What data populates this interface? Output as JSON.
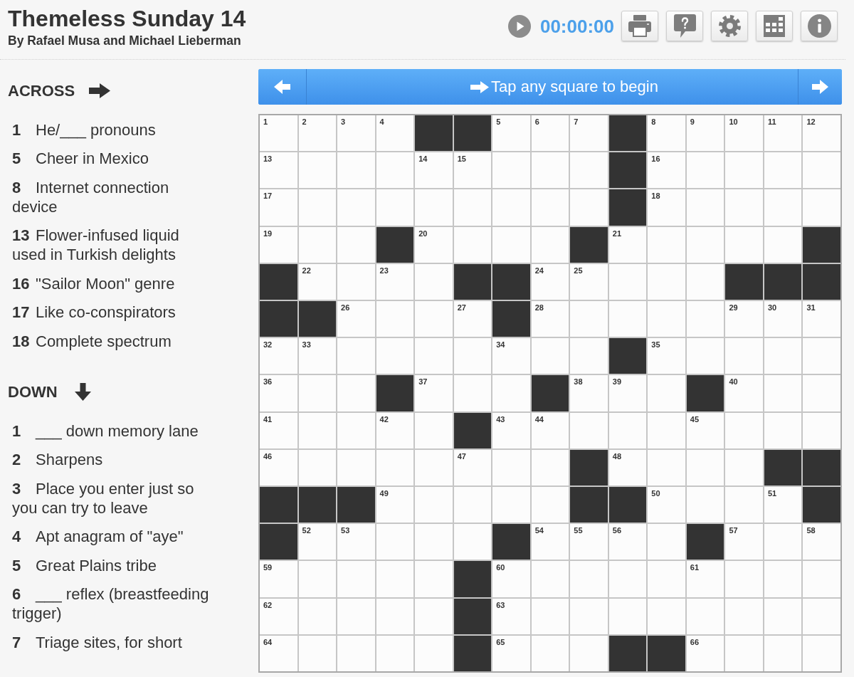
{
  "header": {
    "title": "Themeless Sunday 14",
    "byline": "By Rafael Musa and Michael Lieberman"
  },
  "toolbar": {
    "timer": "00:00:00"
  },
  "clue_bar": {
    "message": "Tap any square to begin"
  },
  "clues": {
    "across": {
      "heading": "ACROSS",
      "items": [
        {
          "number": "1",
          "text": "He/___ pronouns"
        },
        {
          "number": "5",
          "text": "Cheer in Mexico"
        },
        {
          "number": "8",
          "text": "Internet connection device"
        },
        {
          "number": "13",
          "text": "Flower-infused liquid used in Turkish delights"
        },
        {
          "number": "16",
          "text": "\"Sailor Moon\" genre"
        },
        {
          "number": "17",
          "text": "Like co-conspirators"
        },
        {
          "number": "18",
          "text": "Complete spectrum"
        }
      ]
    },
    "down": {
      "heading": "DOWN",
      "items": [
        {
          "number": "1",
          "text": "___ down memory lane"
        },
        {
          "number": "2",
          "text": "Sharpens"
        },
        {
          "number": "3",
          "text": "Place you enter just so you can try to leave"
        },
        {
          "number": "4",
          "text": "Apt anagram of \"aye\""
        },
        {
          "number": "5",
          "text": "Great Plains tribe"
        },
        {
          "number": "6",
          "text": "___ reflex (breastfeeding trigger)"
        },
        {
          "number": "7",
          "text": "Triage sites, for short"
        }
      ]
    }
  },
  "grid": {
    "rows": [
      [
        {
          "kind": "open",
          "number": "1"
        },
        {
          "kind": "open",
          "number": "2"
        },
        {
          "kind": "open",
          "number": "3"
        },
        {
          "kind": "open",
          "number": "4"
        },
        {
          "kind": "block"
        },
        {
          "kind": "block"
        },
        {
          "kind": "open",
          "number": "5"
        },
        {
          "kind": "open",
          "number": "6"
        },
        {
          "kind": "open",
          "number": "7"
        },
        {
          "kind": "block"
        },
        {
          "kind": "open",
          "number": "8"
        },
        {
          "kind": "open",
          "number": "9"
        },
        {
          "kind": "open",
          "number": "10"
        },
        {
          "kind": "open",
          "number": "11"
        },
        {
          "kind": "open",
          "number": "12"
        }
      ],
      [
        {
          "kind": "open",
          "number": "13"
        },
        {
          "kind": "open"
        },
        {
          "kind": "open"
        },
        {
          "kind": "open"
        },
        {
          "kind": "open",
          "number": "14"
        },
        {
          "kind": "open",
          "number": "15"
        },
        {
          "kind": "open"
        },
        {
          "kind": "open"
        },
        {
          "kind": "open"
        },
        {
          "kind": "block"
        },
        {
          "kind": "open",
          "number": "16"
        },
        {
          "kind": "open"
        },
        {
          "kind": "open"
        },
        {
          "kind": "open"
        },
        {
          "kind": "open"
        }
      ],
      [
        {
          "kind": "open",
          "number": "17"
        },
        {
          "kind": "open"
        },
        {
          "kind": "open"
        },
        {
          "kind": "open"
        },
        {
          "kind": "open"
        },
        {
          "kind": "open"
        },
        {
          "kind": "open"
        },
        {
          "kind": "open"
        },
        {
          "kind": "open"
        },
        {
          "kind": "block"
        },
        {
          "kind": "open",
          "number": "18"
        },
        {
          "kind": "open"
        },
        {
          "kind": "open"
        },
        {
          "kind": "open"
        },
        {
          "kind": "open"
        }
      ],
      [
        {
          "kind": "open",
          "number": "19"
        },
        {
          "kind": "open"
        },
        {
          "kind": "open"
        },
        {
          "kind": "block"
        },
        {
          "kind": "open",
          "number": "20"
        },
        {
          "kind": "open"
        },
        {
          "kind": "open"
        },
        {
          "kind": "open"
        },
        {
          "kind": "block"
        },
        {
          "kind": "open",
          "number": "21"
        },
        {
          "kind": "open"
        },
        {
          "kind": "open"
        },
        {
          "kind": "open"
        },
        {
          "kind": "open"
        },
        {
          "kind": "block"
        }
      ],
      [
        {
          "kind": "block"
        },
        {
          "kind": "open",
          "number": "22"
        },
        {
          "kind": "open"
        },
        {
          "kind": "open",
          "number": "23"
        },
        {
          "kind": "open"
        },
        {
          "kind": "block"
        },
        {
          "kind": "block"
        },
        {
          "kind": "open",
          "number": "24"
        },
        {
          "kind": "open",
          "number": "25"
        },
        {
          "kind": "open"
        },
        {
          "kind": "open"
        },
        {
          "kind": "open"
        },
        {
          "kind": "block"
        },
        {
          "kind": "block"
        },
        {
          "kind": "block"
        }
      ],
      [
        {
          "kind": "block"
        },
        {
          "kind": "block"
        },
        {
          "kind": "open",
          "number": "26"
        },
        {
          "kind": "open"
        },
        {
          "kind": "open"
        },
        {
          "kind": "open",
          "number": "27"
        },
        {
          "kind": "block"
        },
        {
          "kind": "open",
          "number": "28"
        },
        {
          "kind": "open"
        },
        {
          "kind": "open"
        },
        {
          "kind": "open"
        },
        {
          "kind": "open"
        },
        {
          "kind": "open",
          "number": "29"
        },
        {
          "kind": "open",
          "number": "30"
        },
        {
          "kind": "open",
          "number": "31"
        }
      ],
      [
        {
          "kind": "open",
          "number": "32"
        },
        {
          "kind": "open",
          "number": "33"
        },
        {
          "kind": "open"
        },
        {
          "kind": "open"
        },
        {
          "kind": "open"
        },
        {
          "kind": "open"
        },
        {
          "kind": "open",
          "number": "34"
        },
        {
          "kind": "open"
        },
        {
          "kind": "open"
        },
        {
          "kind": "block"
        },
        {
          "kind": "open",
          "number": "35"
        },
        {
          "kind": "open"
        },
        {
          "kind": "open"
        },
        {
          "kind": "open"
        },
        {
          "kind": "open"
        }
      ],
      [
        {
          "kind": "open",
          "number": "36"
        },
        {
          "kind": "open"
        },
        {
          "kind": "open"
        },
        {
          "kind": "block"
        },
        {
          "kind": "open",
          "number": "37"
        },
        {
          "kind": "open"
        },
        {
          "kind": "open"
        },
        {
          "kind": "block"
        },
        {
          "kind": "open",
          "number": "38"
        },
        {
          "kind": "open",
          "number": "39"
        },
        {
          "kind": "open"
        },
        {
          "kind": "block"
        },
        {
          "kind": "open",
          "number": "40"
        },
        {
          "kind": "open"
        },
        {
          "kind": "open"
        }
      ],
      [
        {
          "kind": "open",
          "number": "41"
        },
        {
          "kind": "open"
        },
        {
          "kind": "open"
        },
        {
          "kind": "open",
          "number": "42"
        },
        {
          "kind": "open"
        },
        {
          "kind": "block"
        },
        {
          "kind": "open",
          "number": "43"
        },
        {
          "kind": "open",
          "number": "44"
        },
        {
          "kind": "open"
        },
        {
          "kind": "open"
        },
        {
          "kind": "open"
        },
        {
          "kind": "open",
          "number": "45"
        },
        {
          "kind": "open"
        },
        {
          "kind": "open"
        },
        {
          "kind": "open"
        }
      ],
      [
        {
          "kind": "open",
          "number": "46"
        },
        {
          "kind": "open"
        },
        {
          "kind": "open"
        },
        {
          "kind": "open"
        },
        {
          "kind": "open"
        },
        {
          "kind": "open",
          "number": "47"
        },
        {
          "kind": "open"
        },
        {
          "kind": "open"
        },
        {
          "kind": "block"
        },
        {
          "kind": "open",
          "number": "48"
        },
        {
          "kind": "open"
        },
        {
          "kind": "open"
        },
        {
          "kind": "open"
        },
        {
          "kind": "block"
        },
        {
          "kind": "block"
        }
      ],
      [
        {
          "kind": "block"
        },
        {
          "kind": "block"
        },
        {
          "kind": "block"
        },
        {
          "kind": "open",
          "number": "49"
        },
        {
          "kind": "open"
        },
        {
          "kind": "open"
        },
        {
          "kind": "open"
        },
        {
          "kind": "open"
        },
        {
          "kind": "block"
        },
        {
          "kind": "block"
        },
        {
          "kind": "open",
          "number": "50"
        },
        {
          "kind": "open"
        },
        {
          "kind": "open"
        },
        {
          "kind": "open",
          "number": "51"
        },
        {
          "kind": "block"
        }
      ],
      [
        {
          "kind": "block"
        },
        {
          "kind": "open",
          "number": "52"
        },
        {
          "kind": "open",
          "number": "53"
        },
        {
          "kind": "open"
        },
        {
          "kind": "open"
        },
        {
          "kind": "open"
        },
        {
          "kind": "block"
        },
        {
          "kind": "open",
          "number": "54"
        },
        {
          "kind": "open",
          "number": "55"
        },
        {
          "kind": "open",
          "number": "56"
        },
        {
          "kind": "open"
        },
        {
          "kind": "block"
        },
        {
          "kind": "open",
          "number": "57"
        },
        {
          "kind": "open"
        },
        {
          "kind": "open",
          "number": "58"
        }
      ],
      [
        {
          "kind": "open",
          "number": "59"
        },
        {
          "kind": "open"
        },
        {
          "kind": "open"
        },
        {
          "kind": "open"
        },
        {
          "kind": "open"
        },
        {
          "kind": "block"
        },
        {
          "kind": "open",
          "number": "60"
        },
        {
          "kind": "open"
        },
        {
          "kind": "open"
        },
        {
          "kind": "open"
        },
        {
          "kind": "open"
        },
        {
          "kind": "open",
          "number": "61"
        },
        {
          "kind": "open"
        },
        {
          "kind": "open"
        },
        {
          "kind": "open"
        }
      ],
      [
        {
          "kind": "open",
          "number": "62"
        },
        {
          "kind": "open"
        },
        {
          "kind": "open"
        },
        {
          "kind": "open"
        },
        {
          "kind": "open"
        },
        {
          "kind": "block"
        },
        {
          "kind": "open",
          "number": "63"
        },
        {
          "kind": "open"
        },
        {
          "kind": "open"
        },
        {
          "kind": "open"
        },
        {
          "kind": "open"
        },
        {
          "kind": "open"
        },
        {
          "kind": "open"
        },
        {
          "kind": "open"
        },
        {
          "kind": "open"
        }
      ],
      [
        {
          "kind": "open",
          "number": "64"
        },
        {
          "kind": "open"
        },
        {
          "kind": "open"
        },
        {
          "kind": "open"
        },
        {
          "kind": "open"
        },
        {
          "kind": "block"
        },
        {
          "kind": "open",
          "number": "65"
        },
        {
          "kind": "open"
        },
        {
          "kind": "open"
        },
        {
          "kind": "block"
        },
        {
          "kind": "block"
        },
        {
          "kind": "open",
          "number": "66"
        },
        {
          "kind": "open"
        },
        {
          "kind": "open"
        },
        {
          "kind": "open"
        }
      ]
    ]
  }
}
